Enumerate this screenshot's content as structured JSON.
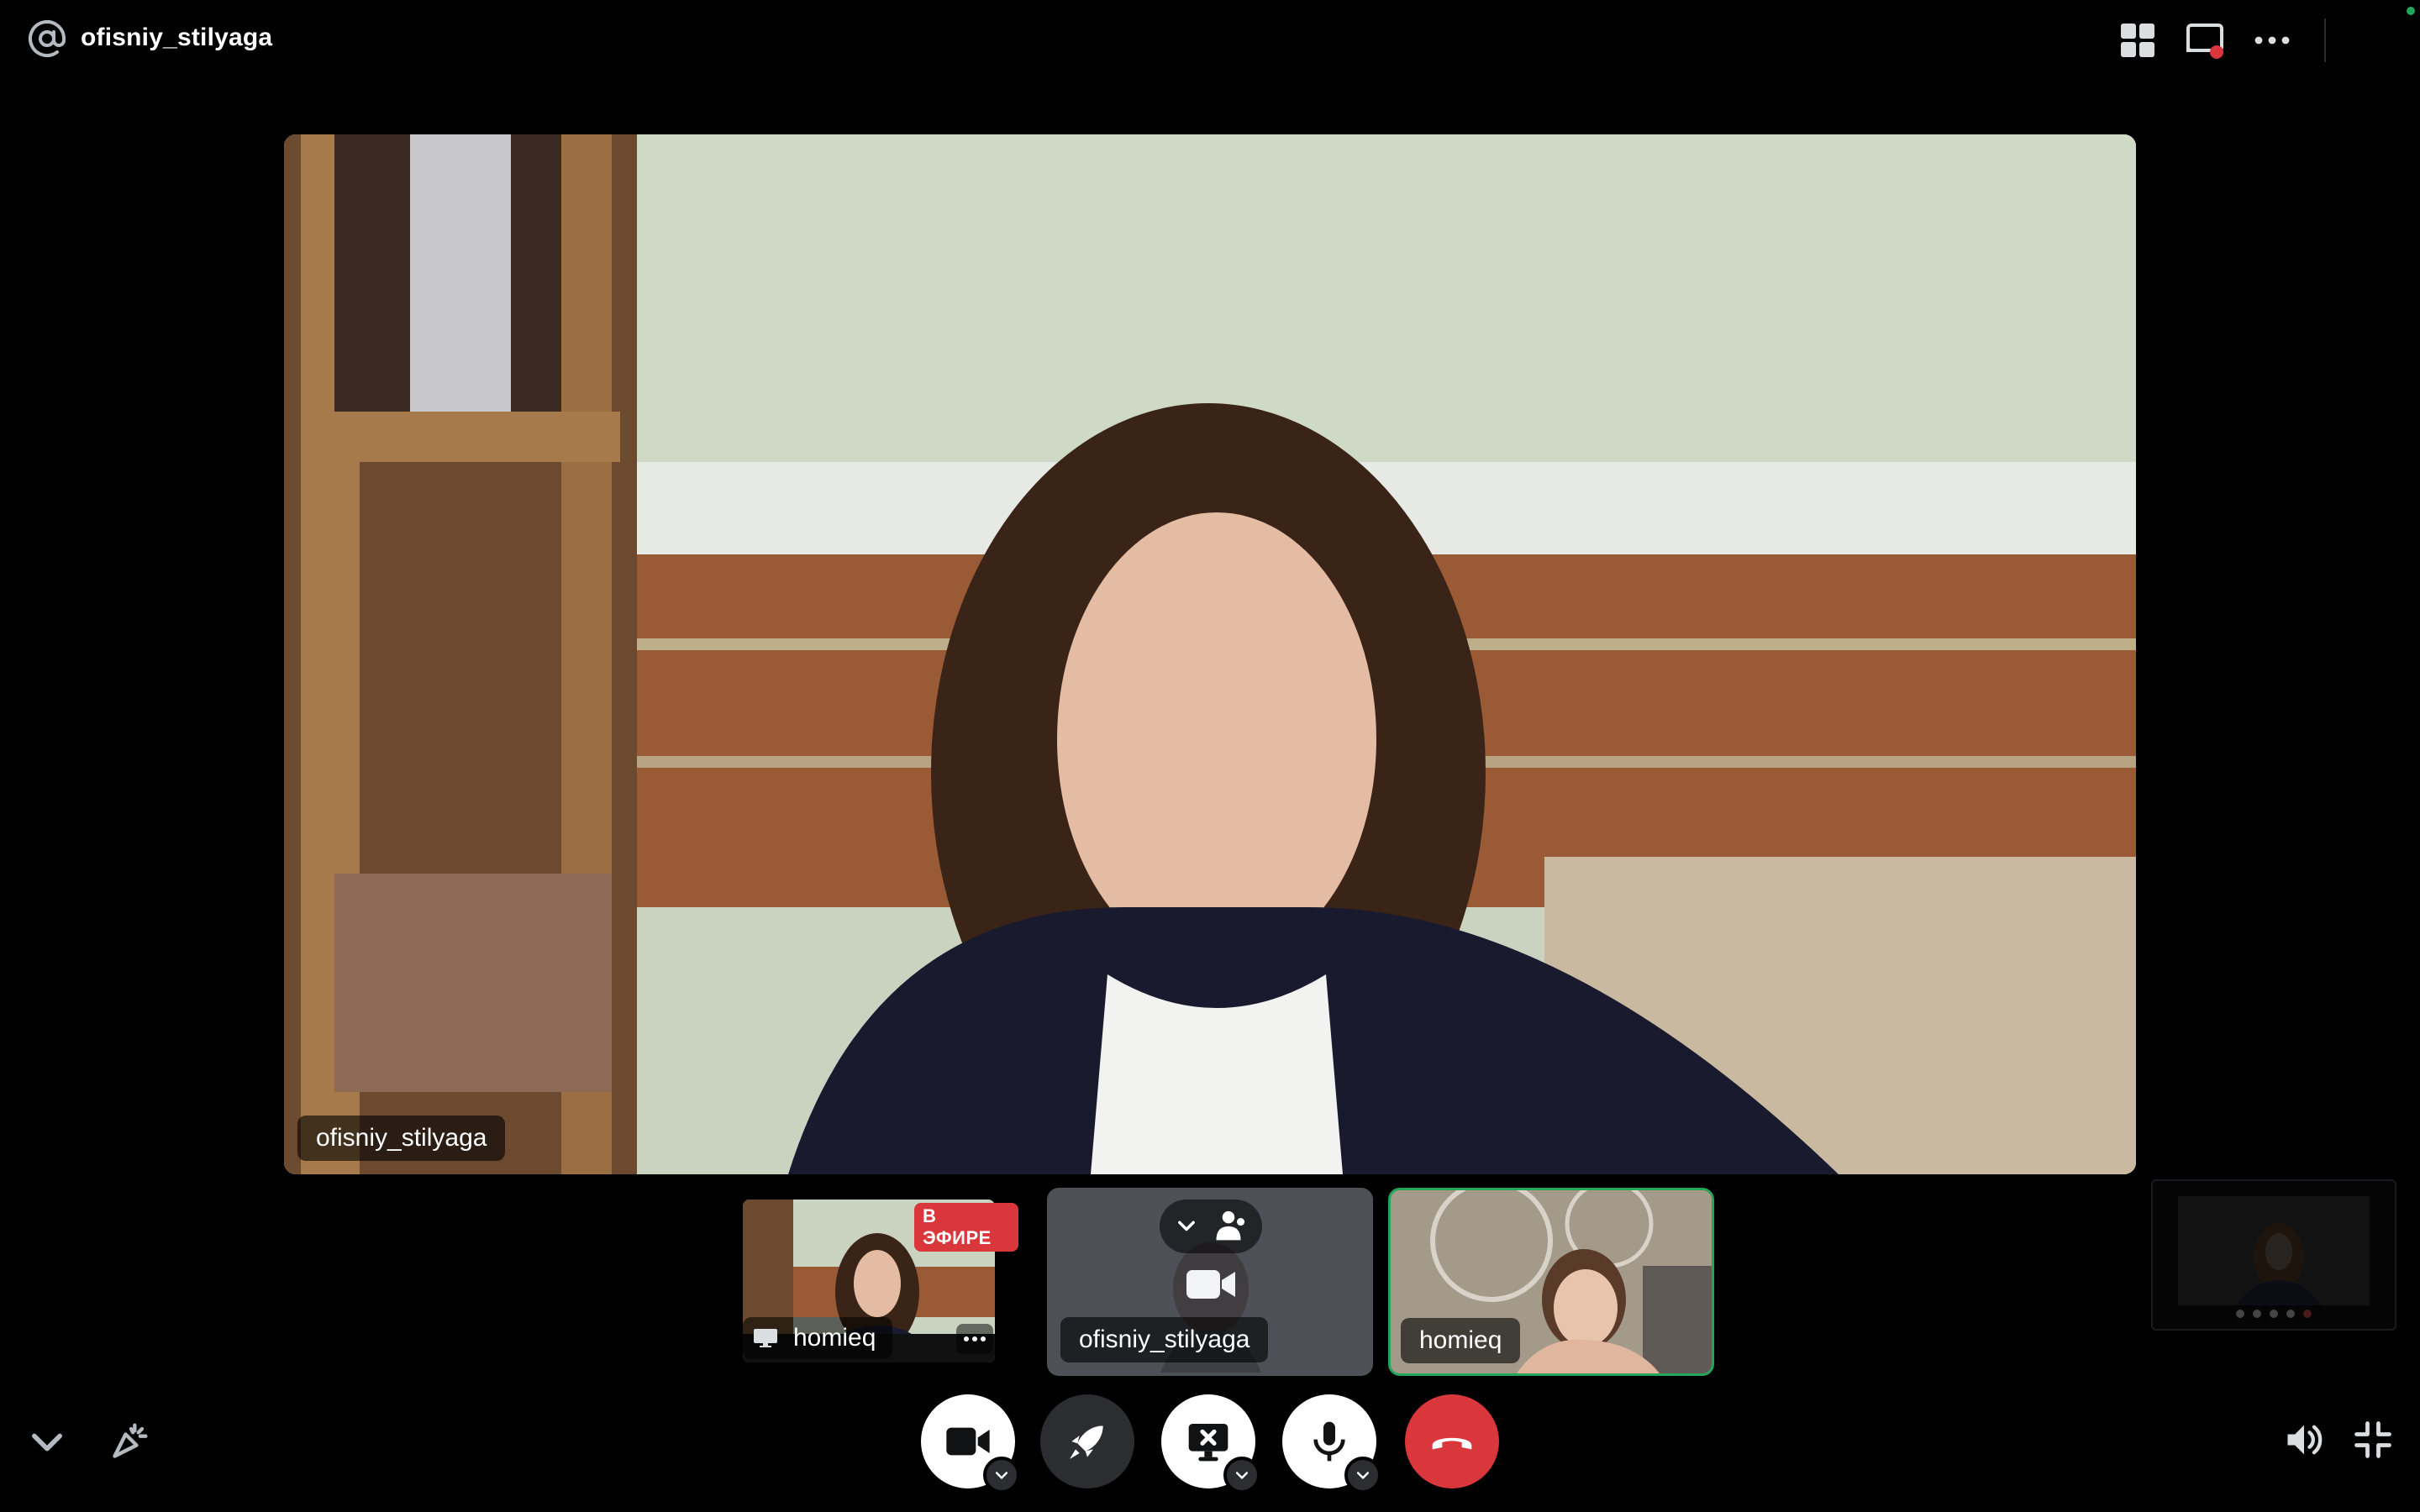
{
  "header": {
    "channel_icon": "at-sign-icon",
    "title": "ofisniy_stilyaga",
    "actions": [
      "grid-icon",
      "popout-icon",
      "more-icon"
    ]
  },
  "main_video": {
    "participant": "ofisniy_stilyaga"
  },
  "tiles": [
    {
      "kind": "stream",
      "participant": "homieq",
      "badge": "В ЭФИРЕ",
      "icon": "screen-share-icon"
    },
    {
      "kind": "self",
      "participant": "ofisniy_stilyaga",
      "icon": "camera-off-icon"
    },
    {
      "kind": "camera",
      "participant": "homieq",
      "speaking": true
    }
  ],
  "controls": [
    "camera-icon",
    "activity-rocket-icon",
    "stop-share-icon",
    "microphone-icon",
    "hang-up-icon"
  ],
  "side_controls": [
    "chevron-down-icon",
    "soundboard-icon",
    "volume-icon",
    "exit-fullscreen-icon"
  ],
  "colors": {
    "background": "#000000",
    "danger": "#da373c",
    "speaking_border": "#23a55a",
    "button_dark": "#2b2d31"
  }
}
